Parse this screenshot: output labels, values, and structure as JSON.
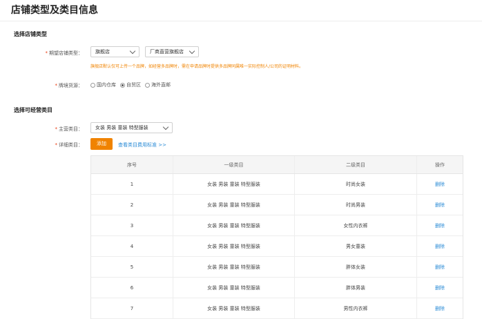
{
  "page": {
    "title": "店铺类型及类目信息"
  },
  "store_type_section": {
    "title": "选择店铺类型",
    "store_type_label": "期望店铺类型：",
    "store_type_value": "旗舰店",
    "store_subtype_value": "厂商直营旗舰店",
    "tip": "旗舰店默认仅可上传一个品牌，如经营多品牌时，需在申请品牌时提供多品牌同属唯一实际控制人/公司的证明材料。",
    "source_label": "牌境货源：",
    "source_options": [
      {
        "label": "国内仓库",
        "checked": false
      },
      {
        "label": "自贸区",
        "checked": true
      },
      {
        "label": "海外直邮",
        "checked": false
      }
    ]
  },
  "category_section": {
    "title": "选择可经营类目",
    "main_category_label": "主营类目：",
    "main_category_value": "女装 男装 童装 特型服装",
    "detail_category_label": "详细类目：",
    "add_button": "添加",
    "fee_link": "查看类目费用标准 >>"
  },
  "table": {
    "headers": [
      "序号",
      "一级类目",
      "二级类目",
      "操作"
    ],
    "rows": [
      {
        "no": "1",
        "level1": "女装 男装 童装 特型服装",
        "level2": "时尚女装",
        "action": "删除"
      },
      {
        "no": "2",
        "level1": "女装 男装 童装 特型服装",
        "level2": "时尚男装",
        "action": "删除"
      },
      {
        "no": "3",
        "level1": "女装 男装 童装 特型服装",
        "level2": "女性内衣裤",
        "action": "删除"
      },
      {
        "no": "4",
        "level1": "女装 男装 童装 特型服装",
        "level2": "男女童装",
        "action": "删除"
      },
      {
        "no": "5",
        "level1": "女装 男装 童装 特型服装",
        "level2": "胖体女装",
        "action": "删除"
      },
      {
        "no": "6",
        "level1": "女装 男装 童装 特型服装",
        "level2": "胖体男装",
        "action": "删除"
      },
      {
        "no": "7",
        "level1": "女装 男装 童装 特型服装",
        "level2": "男性内衣裤",
        "action": "删除"
      }
    ]
  },
  "colors": {
    "accent": "#f08300",
    "link": "#2a8bd6",
    "required": "#e8380d"
  }
}
